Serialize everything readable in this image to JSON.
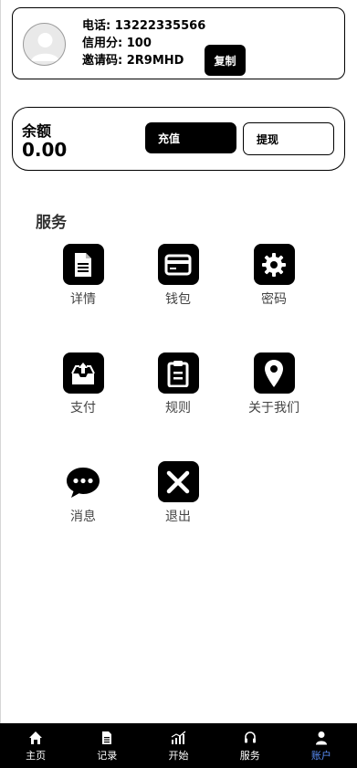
{
  "profile": {
    "phone_label": "电话:",
    "phone": "13222335566",
    "credit_label": "信用分:",
    "credit": "100",
    "invite_label": "邀请码:",
    "invite_code": "2R9MHD",
    "copy_label": "复制"
  },
  "balance": {
    "label": "余额",
    "value": "0.00",
    "recharge_label": "充值",
    "withdraw_label": "提现"
  },
  "services": {
    "title": "服务",
    "items": [
      {
        "label": "详情",
        "icon": "document-icon"
      },
      {
        "label": "钱包",
        "icon": "wallet-icon"
      },
      {
        "label": "密码",
        "icon": "gear-icon"
      },
      {
        "label": "支付",
        "icon": "outbox-icon"
      },
      {
        "label": "规则",
        "icon": "clipboard-icon"
      },
      {
        "label": "关于我们",
        "icon": "location-pin-icon"
      },
      {
        "label": "消息",
        "icon": "chat-bubble-icon"
      },
      {
        "label": "退出",
        "icon": "close-icon"
      }
    ]
  },
  "nav": {
    "items": [
      {
        "label": "主页",
        "icon": "home-icon"
      },
      {
        "label": "记录",
        "icon": "record-icon"
      },
      {
        "label": "开始",
        "icon": "chart-icon"
      },
      {
        "label": "服务",
        "icon": "headset-icon"
      },
      {
        "label": "账户",
        "icon": "user-icon"
      }
    ],
    "active_index": 4,
    "active_color": "#5b8ff9"
  }
}
